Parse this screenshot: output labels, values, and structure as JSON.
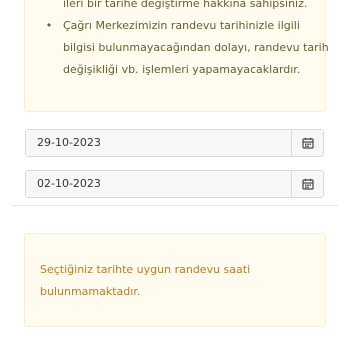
{
  "notice_top": {
    "first_line": "ileri bir tarihe değiştirme hakkına sahipsiniz.",
    "bullet_text": "Çağrı Merkezimizin randevu tarihinizle ilgili bilgisi bulunmayacağından dolayı, randevu tarih değişikliği vb. işlemleri yapamayacaklardır.",
    "bullet_symbol": "•"
  },
  "date_fields": [
    {
      "value": "29-10-2023",
      "icon": "calendar-icon"
    },
    {
      "value": "02-10-2023",
      "icon": "calendar-icon"
    }
  ],
  "notice_bottom": {
    "message": "Seçtiğiniz tarihte uygun randevu saati bulunmamaktadır."
  },
  "colors": {
    "notice_background": "#fffbee",
    "notice_border": "#fcefc8",
    "notice_text": "#6b5b2e",
    "warning_text": "#c47a1e",
    "input_background": "#f7f7f7",
    "input_border": "#d9d9d9"
  }
}
